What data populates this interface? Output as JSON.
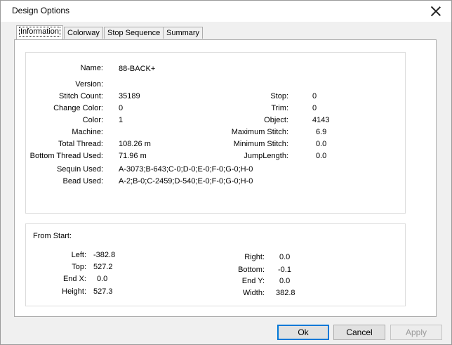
{
  "window": {
    "title": "Design Options"
  },
  "tabs": [
    "Information",
    "Colorway",
    "Stop Sequence",
    "Summary"
  ],
  "info": {
    "name_label": "Name:",
    "name": "88-BACK+",
    "version_label": "Version:",
    "version": "",
    "stitch_count_label": "Stitch Count:",
    "stitch_count": "35189",
    "change_color_label": "Change Color:",
    "change_color": "0",
    "color_label": "Color:",
    "color": "1",
    "machine_label": "Machine:",
    "machine": "",
    "total_thread_label": "Total Thread:",
    "total_thread": "108.26 m",
    "bottom_thread_label": "Bottom Thread Used:",
    "bottom_thread": "71.96 m",
    "sequin_label": "Sequin Used:",
    "sequin": "A-3073;B-643;C-0;D-0;E-0;F-0;G-0;H-0",
    "bead_label": "Bead Used:",
    "bead": "A-2;B-0;C-2459;D-540;E-0;F-0;G-0;H-0",
    "stop_label": "Stop:",
    "stop": "0",
    "trim_label": "Trim:",
    "trim": "0",
    "object_label": "Object:",
    "object": "4143",
    "max_stitch_label": "Maximum Stitch:",
    "max_stitch": "6.9",
    "min_stitch_label": "Minimum Stitch:",
    "min_stitch": "0.0",
    "jump_length_label": "JumpLength:",
    "jump_length": "0.0"
  },
  "from_start": {
    "heading": "From Start:",
    "left_label": "Left:",
    "left": "-382.8",
    "top_label": "Top:",
    "top": "527.2",
    "endx_label": "End X:",
    "endx": "0.0",
    "height_label": "Height:",
    "height": "527.3",
    "right_label": "Right:",
    "right": "0.0",
    "bottom_label": "Bottom:",
    "bottom": "-0.1",
    "endy_label": "End Y:",
    "endy": "0.0",
    "width_label": "Width:",
    "width": "382.8"
  },
  "buttons": {
    "ok": "Ok",
    "cancel": "Cancel",
    "apply": "Apply"
  }
}
